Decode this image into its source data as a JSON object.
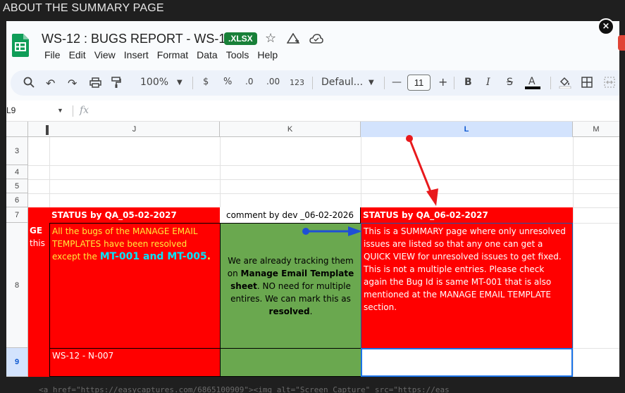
{
  "page_heading": "ABOUT THE SUMMARY PAGE",
  "bottom_overlay_text": "<a href=\"https://easycaptures.com/6865100909\"><img alt=\"Screen Capture\" src=\"https://eas",
  "close_label": "×",
  "app": {
    "doc_title": "WS-12 : BUGS REPORT - WS-12",
    "file_badge": ".XLSX",
    "menu": [
      "File",
      "Edit",
      "View",
      "Insert",
      "Format",
      "Data",
      "Tools",
      "Help"
    ]
  },
  "toolbar": {
    "zoom": "100%",
    "currency": "$",
    "percent": "%",
    "dec_decrease": ".0",
    "dec_increase": ".00",
    "number_format": "123",
    "font_name": "Defaul...",
    "font_size": "11",
    "minus": "—",
    "plus": "+",
    "bold": "B",
    "italic": "I"
  },
  "formula_bar": {
    "name_box": "L9",
    "fx": "fx",
    "value": ""
  },
  "columns": [
    "J",
    "K",
    "L",
    "M"
  ],
  "rows": [
    "3",
    "4",
    "5",
    "6",
    "7",
    "8",
    "9"
  ],
  "cells": {
    "J7": "STATUS by QA_05-02-2027",
    "K7": "comment by dev _06-02-2026",
    "L7": "STATUS by QA_06-02-2027",
    "I8_line1": "GE",
    "I8_line2": "this",
    "J8_main": "All the bugs of the MANAGE EMAIL TEMPLATES  have been resolved except the ",
    "J8_highlight": "MT-001 and MT-005",
    "J8_end": ".",
    "K8_pre": "We are already tracking them on ",
    "K8_bold1": "Manage Email Template sheet",
    "K8_mid": ". NO need for multiple entires. We can mark this as ",
    "K8_bold2": "resolved",
    "K8_end": ".",
    "L8": "This is a SUMMARY page where only unresolved issues are listed so that any one can get a QUICK VIEW for unresolved issues to get fixed.  This is not a multiple entries. Please check again the Bug Id is same MT-001 that is also mentioned at the MANAGE EMAIL TEMPLATE section.",
    "J9": "WS-12 - N-007"
  },
  "colors": {
    "red_fill": "#ff0000",
    "green_fill": "#6aa84f",
    "selection": "#1a73e8",
    "annotation_red": "#e8191c",
    "annotation_blue": "#1e4fd6",
    "highlight_cyan": "#00e5ff",
    "highlight_yellow": "#ffeb3b"
  },
  "icons": [
    "sheets-logo-icon",
    "star-icon",
    "move-to-drive-icon",
    "cloud-status-icon",
    "search-icon",
    "undo-icon",
    "redo-icon",
    "print-icon",
    "paint-format-icon",
    "strikethrough-icon",
    "text-color-icon",
    "fill-color-icon",
    "borders-icon",
    "merge-icon",
    "close-icon"
  ]
}
